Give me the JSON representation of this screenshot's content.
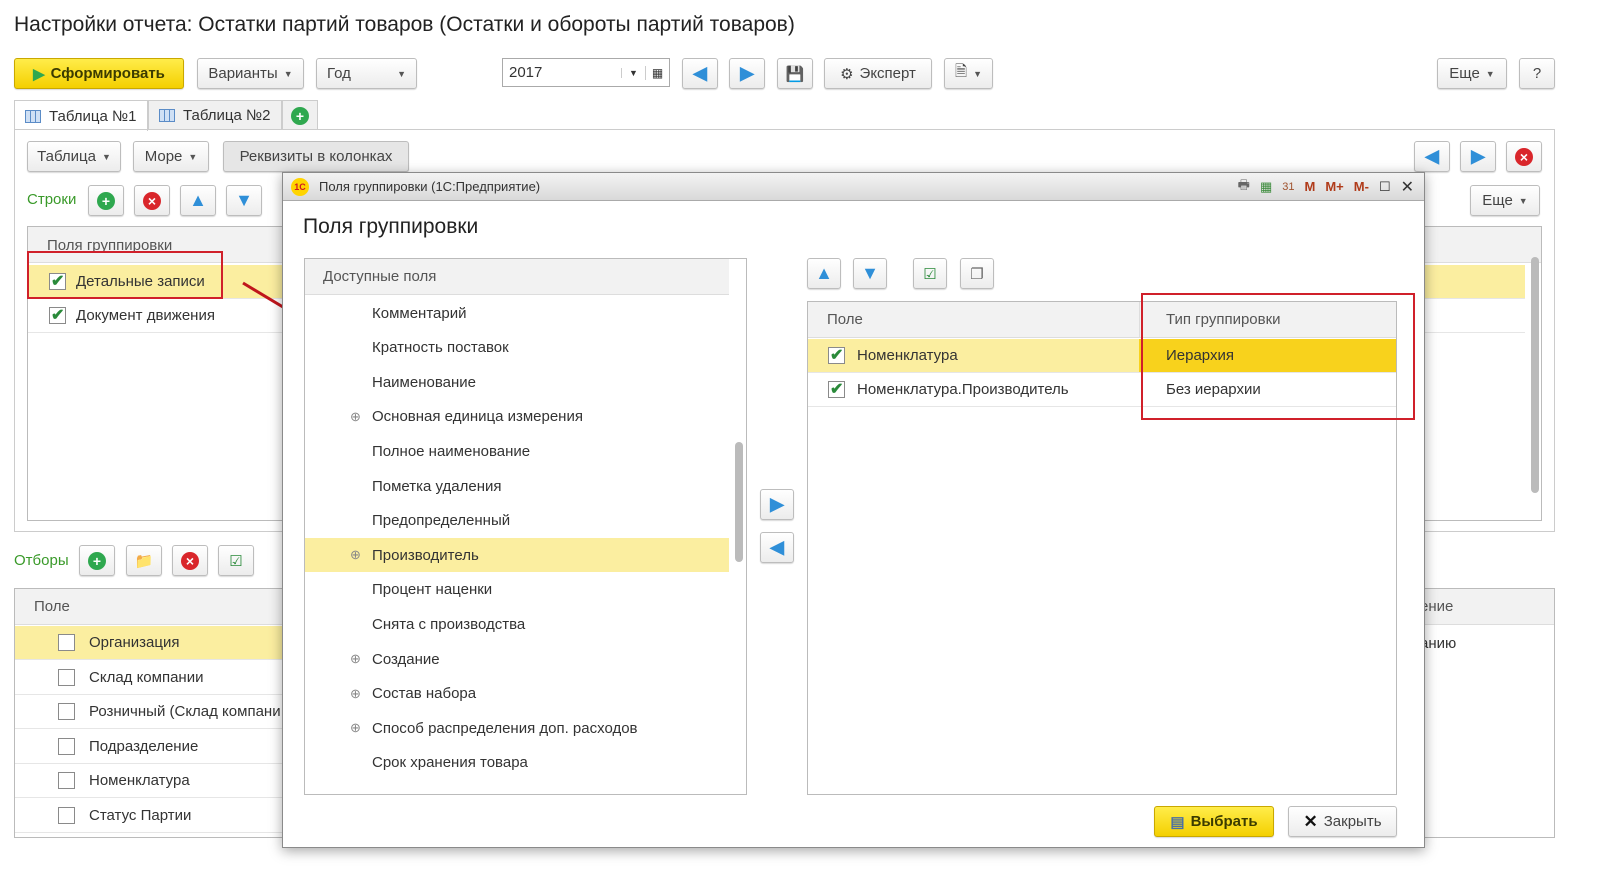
{
  "title": "Настройки отчета: Остатки партий товаров (Остатки и обороты партий товаров)",
  "toolbar": {
    "generate": "Сформировать",
    "variants": "Варианты",
    "period": "Год",
    "year": "2017",
    "expert": "Эксперт",
    "more": "Еще",
    "help": "?"
  },
  "tabs": [
    {
      "label": "Таблица №1"
    },
    {
      "label": "Таблица №2"
    }
  ],
  "inner_toolbar": {
    "table": "Таблица",
    "more": "Море",
    "columns": "Реквизиты в колонках",
    "more2": "Еще"
  },
  "rows_section": {
    "label": "Строки",
    "header": "Поля группировки",
    "items": [
      {
        "label": "Детальные записи",
        "checked": true
      },
      {
        "label": "Документ движения",
        "checked": true
      }
    ]
  },
  "filters": {
    "label": "Отборы",
    "header": "Поле",
    "header_right": "ение",
    "items": [
      {
        "label": "Организация",
        "checked": false,
        "right": "анию"
      },
      {
        "label": "Склад компании",
        "checked": false
      },
      {
        "label": "Розничный (Склад компани",
        "checked": false
      },
      {
        "label": "Подразделение",
        "checked": false
      },
      {
        "label": "Номенклатура",
        "checked": false
      },
      {
        "label": "Статус Партии",
        "checked": false
      }
    ]
  },
  "dialog": {
    "window_title": "Поля группировки  (1С:Предприятие)",
    "logo": "1С",
    "title_tools": [
      "M",
      "M+",
      "M-"
    ],
    "heading": "Поля группировки",
    "available": {
      "header": "Доступные поля",
      "items": [
        {
          "label": "Комментарий",
          "expandable": false
        },
        {
          "label": "Кратность поставок",
          "expandable": false
        },
        {
          "label": "Наименование",
          "expandable": false
        },
        {
          "label": "Основная единица измерения",
          "expandable": true
        },
        {
          "label": "Полное наименование",
          "expandable": false
        },
        {
          "label": "Пометка удаления",
          "expandable": false
        },
        {
          "label": "Предопределенный",
          "expandable": false
        },
        {
          "label": "Производитель",
          "expandable": true,
          "selected": true
        },
        {
          "label": "Процент наценки",
          "expandable": false
        },
        {
          "label": "Снята с производства",
          "expandable": false
        },
        {
          "label": "Создание",
          "expandable": true
        },
        {
          "label": "Состав набора",
          "expandable": true
        },
        {
          "label": "Способ распределения доп. расходов",
          "expandable": true
        },
        {
          "label": "Срок хранения товара",
          "expandable": false
        }
      ]
    },
    "selected": {
      "col_field": "Поле",
      "col_type": "Тип группировки",
      "rows": [
        {
          "field": "Номенклатура",
          "type": "Иерархия",
          "checked": true
        },
        {
          "field": "Номенклатура.Производитель",
          "type": "Без иерархии",
          "checked": true
        }
      ]
    },
    "choose": "Выбрать",
    "close": "Закрыть"
  },
  "colors": {
    "accent_yellow": "#f4d000",
    "highlight": "#fbeea0",
    "annotation_red": "#d0202a",
    "section_green": "#3a9a2a"
  }
}
